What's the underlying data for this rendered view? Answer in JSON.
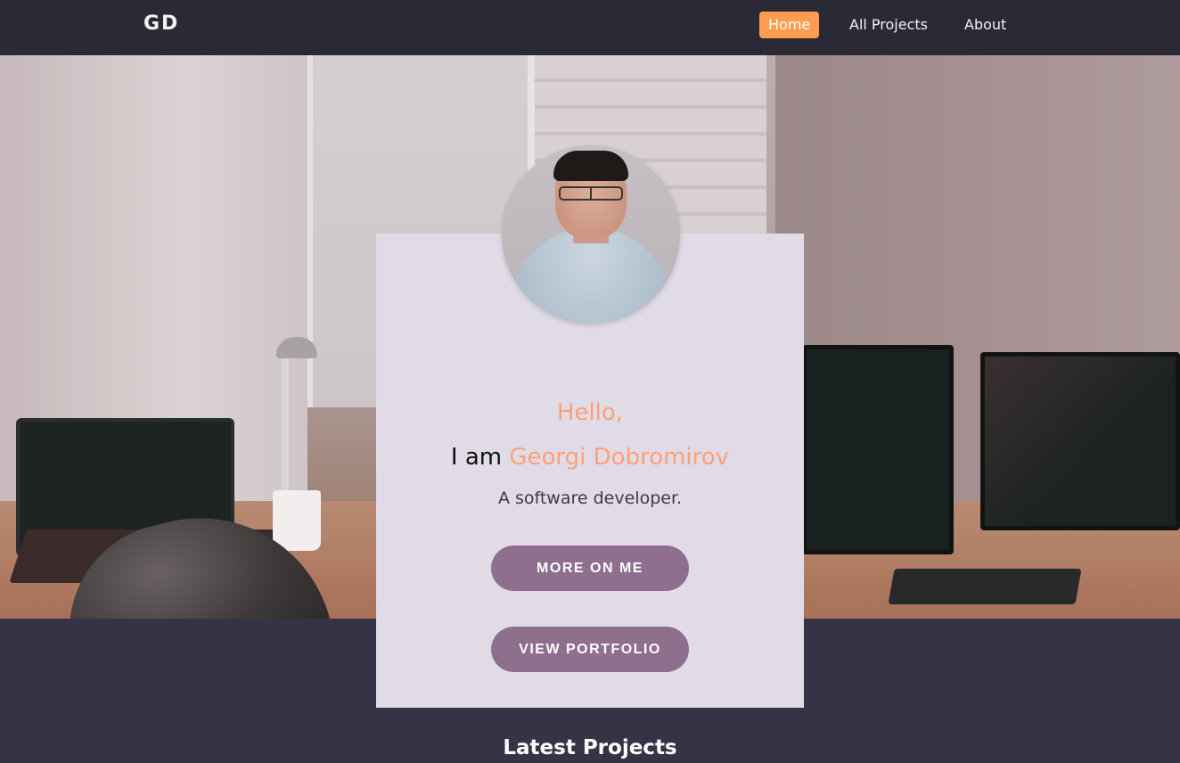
{
  "navbar": {
    "brand": "GD",
    "links": [
      {
        "label": "Home",
        "active": true
      },
      {
        "label": "All Projects",
        "active": false
      },
      {
        "label": "About",
        "active": false
      }
    ]
  },
  "profile": {
    "greeting": "Hello,",
    "intro_prefix": "I am",
    "name": "Georgi Dobromirov",
    "role": "A software developer.",
    "buttons": {
      "more": "MORE ON ME",
      "portfolio": "VIEW PORTFOLIO"
    }
  },
  "section": {
    "title": "Latest Projects"
  },
  "colors": {
    "accent": "#ffa07a",
    "nav_active": "#ff9c4f",
    "button": "#8e708e",
    "card": "#e0dbe6",
    "navbar_bg": "#2a2a37",
    "page_bg": "#343446"
  }
}
